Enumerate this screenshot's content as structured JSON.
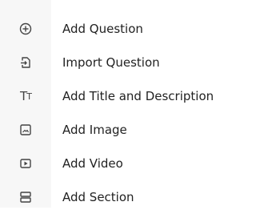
{
  "menu": {
    "items": [
      {
        "label": "Add Question",
        "icon": "add-circle-icon"
      },
      {
        "label": "Import Question",
        "icon": "import-icon"
      },
      {
        "label": "Add Title and Description",
        "icon": "text-title-icon",
        "icon_glyph_big": "T",
        "icon_glyph_small": "T"
      },
      {
        "label": "Add Image",
        "icon": "image-icon"
      },
      {
        "label": "Add Video",
        "icon": "video-icon"
      },
      {
        "label": "Add Section",
        "icon": "section-icon"
      }
    ]
  }
}
